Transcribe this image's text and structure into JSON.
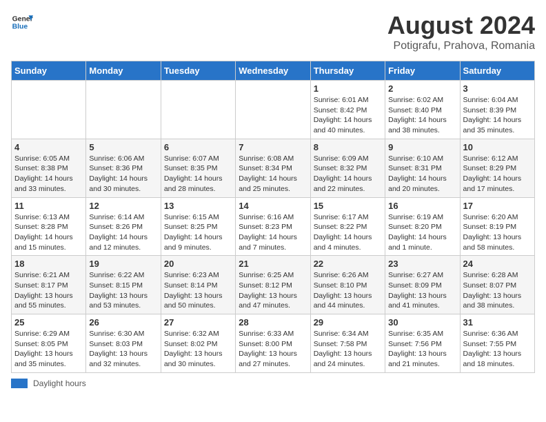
{
  "header": {
    "logo_line1": "General",
    "logo_line2": "Blue",
    "month_year": "August 2024",
    "location": "Potigrafu, Prahova, Romania"
  },
  "weekdays": [
    "Sunday",
    "Monday",
    "Tuesday",
    "Wednesday",
    "Thursday",
    "Friday",
    "Saturday"
  ],
  "weeks": [
    [
      {
        "day": "",
        "info": ""
      },
      {
        "day": "",
        "info": ""
      },
      {
        "day": "",
        "info": ""
      },
      {
        "day": "",
        "info": ""
      },
      {
        "day": "1",
        "info": "Sunrise: 6:01 AM\nSunset: 8:42 PM\nDaylight: 14 hours and 40 minutes."
      },
      {
        "day": "2",
        "info": "Sunrise: 6:02 AM\nSunset: 8:40 PM\nDaylight: 14 hours and 38 minutes."
      },
      {
        "day": "3",
        "info": "Sunrise: 6:04 AM\nSunset: 8:39 PM\nDaylight: 14 hours and 35 minutes."
      }
    ],
    [
      {
        "day": "4",
        "info": "Sunrise: 6:05 AM\nSunset: 8:38 PM\nDaylight: 14 hours and 33 minutes."
      },
      {
        "day": "5",
        "info": "Sunrise: 6:06 AM\nSunset: 8:36 PM\nDaylight: 14 hours and 30 minutes."
      },
      {
        "day": "6",
        "info": "Sunrise: 6:07 AM\nSunset: 8:35 PM\nDaylight: 14 hours and 28 minutes."
      },
      {
        "day": "7",
        "info": "Sunrise: 6:08 AM\nSunset: 8:34 PM\nDaylight: 14 hours and 25 minutes."
      },
      {
        "day": "8",
        "info": "Sunrise: 6:09 AM\nSunset: 8:32 PM\nDaylight: 14 hours and 22 minutes."
      },
      {
        "day": "9",
        "info": "Sunrise: 6:10 AM\nSunset: 8:31 PM\nDaylight: 14 hours and 20 minutes."
      },
      {
        "day": "10",
        "info": "Sunrise: 6:12 AM\nSunset: 8:29 PM\nDaylight: 14 hours and 17 minutes."
      }
    ],
    [
      {
        "day": "11",
        "info": "Sunrise: 6:13 AM\nSunset: 8:28 PM\nDaylight: 14 hours and 15 minutes."
      },
      {
        "day": "12",
        "info": "Sunrise: 6:14 AM\nSunset: 8:26 PM\nDaylight: 14 hours and 12 minutes."
      },
      {
        "day": "13",
        "info": "Sunrise: 6:15 AM\nSunset: 8:25 PM\nDaylight: 14 hours and 9 minutes."
      },
      {
        "day": "14",
        "info": "Sunrise: 6:16 AM\nSunset: 8:23 PM\nDaylight: 14 hours and 7 minutes."
      },
      {
        "day": "15",
        "info": "Sunrise: 6:17 AM\nSunset: 8:22 PM\nDaylight: 14 hours and 4 minutes."
      },
      {
        "day": "16",
        "info": "Sunrise: 6:19 AM\nSunset: 8:20 PM\nDaylight: 14 hours and 1 minute."
      },
      {
        "day": "17",
        "info": "Sunrise: 6:20 AM\nSunset: 8:19 PM\nDaylight: 13 hours and 58 minutes."
      }
    ],
    [
      {
        "day": "18",
        "info": "Sunrise: 6:21 AM\nSunset: 8:17 PM\nDaylight: 13 hours and 55 minutes."
      },
      {
        "day": "19",
        "info": "Sunrise: 6:22 AM\nSunset: 8:15 PM\nDaylight: 13 hours and 53 minutes."
      },
      {
        "day": "20",
        "info": "Sunrise: 6:23 AM\nSunset: 8:14 PM\nDaylight: 13 hours and 50 minutes."
      },
      {
        "day": "21",
        "info": "Sunrise: 6:25 AM\nSunset: 8:12 PM\nDaylight: 13 hours and 47 minutes."
      },
      {
        "day": "22",
        "info": "Sunrise: 6:26 AM\nSunset: 8:10 PM\nDaylight: 13 hours and 44 minutes."
      },
      {
        "day": "23",
        "info": "Sunrise: 6:27 AM\nSunset: 8:09 PM\nDaylight: 13 hours and 41 minutes."
      },
      {
        "day": "24",
        "info": "Sunrise: 6:28 AM\nSunset: 8:07 PM\nDaylight: 13 hours and 38 minutes."
      }
    ],
    [
      {
        "day": "25",
        "info": "Sunrise: 6:29 AM\nSunset: 8:05 PM\nDaylight: 13 hours and 35 minutes."
      },
      {
        "day": "26",
        "info": "Sunrise: 6:30 AM\nSunset: 8:03 PM\nDaylight: 13 hours and 32 minutes."
      },
      {
        "day": "27",
        "info": "Sunrise: 6:32 AM\nSunset: 8:02 PM\nDaylight: 13 hours and 30 minutes."
      },
      {
        "day": "28",
        "info": "Sunrise: 6:33 AM\nSunset: 8:00 PM\nDaylight: 13 hours and 27 minutes."
      },
      {
        "day": "29",
        "info": "Sunrise: 6:34 AM\nSunset: 7:58 PM\nDaylight: 13 hours and 24 minutes."
      },
      {
        "day": "30",
        "info": "Sunrise: 6:35 AM\nSunset: 7:56 PM\nDaylight: 13 hours and 21 minutes."
      },
      {
        "day": "31",
        "info": "Sunrise: 6:36 AM\nSunset: 7:55 PM\nDaylight: 13 hours and 18 minutes."
      }
    ]
  ],
  "legend": {
    "label": "Daylight hours"
  }
}
